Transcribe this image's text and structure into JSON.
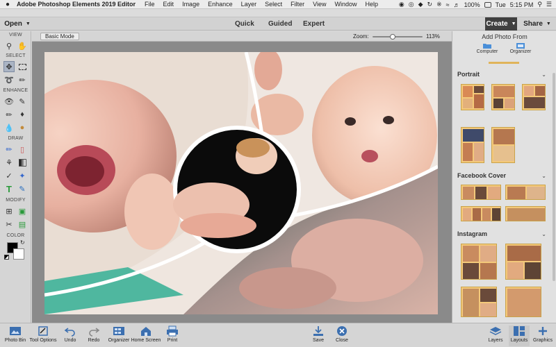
{
  "menubar": {
    "app_name": "Adobe Photoshop Elements 2019 Editor",
    "items": [
      "File",
      "Edit",
      "Image",
      "Enhance",
      "Layer",
      "Select",
      "Filter",
      "View",
      "Window",
      "Help"
    ],
    "battery": "100%",
    "day": "Tue",
    "time": "5:15 PM"
  },
  "modebar": {
    "open_label": "Open",
    "tabs": [
      "Quick",
      "Guided",
      "Expert"
    ],
    "create_label": "Create",
    "share_label": "Share"
  },
  "toolbox": {
    "sections": [
      "VIEW",
      "SELECT",
      "ENHANCE",
      "DRAW",
      "MODIFY",
      "COLOR"
    ]
  },
  "workspace": {
    "basic_mode_label": "Basic Mode",
    "zoom_label": "Zoom:",
    "zoom_value": "113%",
    "zoom_fraction": 0.4
  },
  "right_panel": {
    "add_photo_title": "Add Photo From",
    "sources": [
      "Computer",
      "Organizer"
    ],
    "categories": [
      "Portrait",
      "Facebook Cover",
      "Instagram"
    ]
  },
  "bottombar": {
    "left": [
      "Photo Bin",
      "Tool Options",
      "Undo",
      "Redo",
      "Organizer",
      "Home Screen",
      "Print"
    ],
    "center": [
      "Save",
      "Close"
    ],
    "right": [
      "Layers",
      "Layouts",
      "Graphics"
    ]
  },
  "colors": {
    "accent_dark": "#404040",
    "foreground_color": "#000000",
    "background_color": "#ffffff",
    "template_gold": "#f4c97a"
  }
}
